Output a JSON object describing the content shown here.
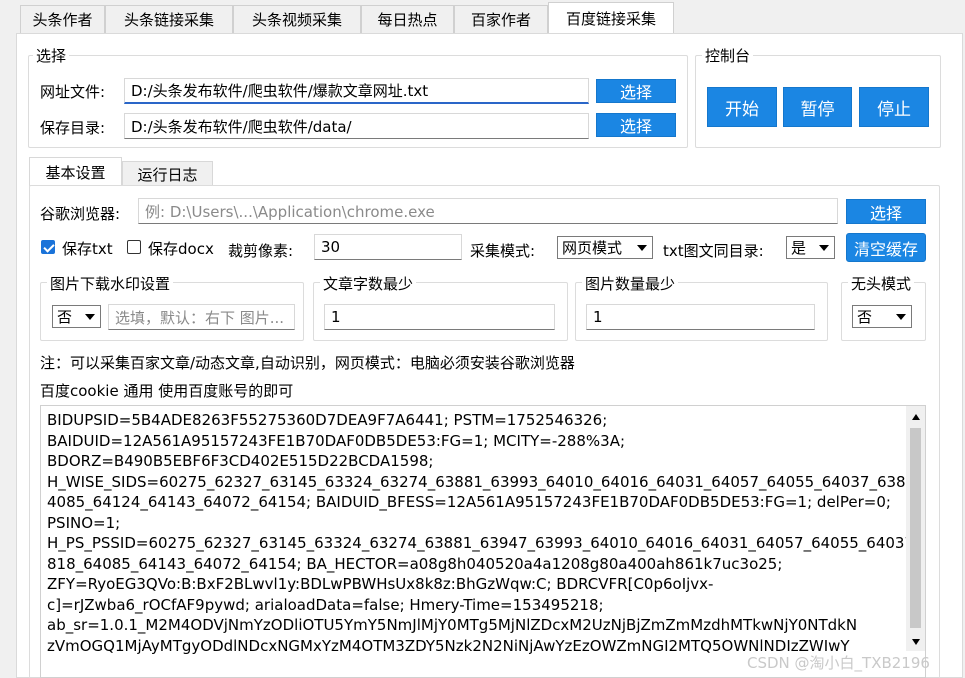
{
  "tabs": [
    "头条作者",
    "头条链接采集",
    "头条视频采集",
    "每日热点",
    "百家作者",
    "百度链接采集"
  ],
  "select_group": {
    "title": "选择",
    "url_file_label": "网址文件:",
    "url_file_value": "D:/头条发布软件/爬虫软件/爆款文章网址.txt",
    "save_dir_label": "保存目录:",
    "save_dir_value": "D:/头条发布软件/爬虫软件/data/",
    "choose_label": "选择"
  },
  "console": {
    "title": "控制台",
    "start": "开始",
    "pause": "暂停",
    "stop": "停止"
  },
  "subtabs": [
    "基本设置",
    "运行日志"
  ],
  "settings": {
    "chrome_label": "谷歌浏览器:",
    "chrome_placeholder": "例: D:\\Users\\...\\Application\\chrome.exe",
    "choose_label": "选择",
    "save_txt": "保存txt",
    "save_docx": "保存docx",
    "crop_label": "裁剪像素:",
    "crop_value": "30",
    "mode_label": "采集模式:",
    "mode_value": "网页模式",
    "txt_same_dir_label": "txt图文同目录:",
    "txt_same_dir_value": "是",
    "clear_cache": "清空缓存",
    "watermark_title": "图片下载水印设置",
    "watermark_value": "否",
    "watermark_placeholder": "选填，默认：右下 图片...",
    "min_words_title": "文章字数最少",
    "min_words_value": "1",
    "min_images_title": "图片数量最少",
    "min_images_value": "1",
    "headless_title": "无头模式",
    "headless_value": "否",
    "note": "注：可以采集百家文章/动态文章,自动识别，网页模式：电脑必须安装谷歌浏览器",
    "cookie_label": "百度cookie 通用 使用百度账号的即可"
  },
  "cookie_lines": [
    "BIDUPSID=5B4ADE8263F55275360D7DEA9F7A6441; PSTM=1752546326;",
    "BAIDUID=12A561A95157243FE1B70DAF0DB5DE53:FG=1; MCITY=-288%3A;",
    "BDORZ=B490B5EBF6F3CD402E515D22BCDA1598;",
    "H_WISE_SIDS=60275_62327_63145_63324_63274_63881_63993_64010_64016_64031_64057_64055_64037_63818_6",
    "4085_64124_64143_64072_64154; BAIDUID_BFESS=12A561A95157243FE1B70DAF0DB5DE53:FG=1; delPer=0;",
    "PSINO=1;",
    "H_PS_PSSID=60275_62327_63145_63324_63274_63881_63947_63993_64010_64016_64031_64057_64055_64037_63",
    "818_64085_64143_64072_64154; BA_HECTOR=a08g8h040520a4a1208g80a400ah861k7uc3o25;",
    "ZFY=RyoEG3QVo:B:BxF2BLwvl1y:BDLwPBWHsUx8k8z:BhGzWqw:C; BDRCVFR[C0p6oIjvx-",
    "c]=rJZwba6_rOCfAF9pywd; arialoadData=false; Hmery-Time=153495218;",
    "ab_sr=1.0.1_M2M4ODVjNmYzODliOTU5YmY5NmJlMjY0MTg5MjNlZDcxM2UzNjBjZmZmMzdhMTkwNjY0NTdkN",
    "zVmOGQ1MjAyMTgyODdlNDcxNGMxYzM4OTM3ZDY5Nzk2N2NiNjAwYzEzOWZmNGI2MTQ5OWNlNDIzZWIwY"
  ],
  "watermark_text": "CSDN @淘小白_TXB2196"
}
